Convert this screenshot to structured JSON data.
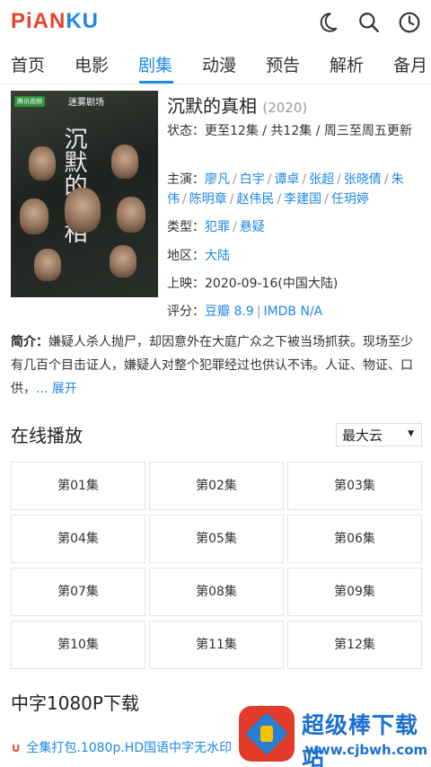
{
  "brand": {
    "logo_pian": "PiAN",
    "logo_ku": "KU"
  },
  "topbar": {
    "icons": [
      "moon-icon",
      "search-icon",
      "history-clock-icon"
    ]
  },
  "nav": {
    "items": [
      "首页",
      "电影",
      "剧集",
      "动漫",
      "预告",
      "解析",
      "备月"
    ],
    "active_index": 2
  },
  "poster": {
    "badge": "腾讯视频",
    "brand": "迷雾剧场",
    "title": "沉默的真相"
  },
  "detail": {
    "title": "沉默的真相",
    "year": "(2020)",
    "status_label": "状态：",
    "status": "更至12集 / 共12集 / 周三至周五更新",
    "cast_label": "主演：",
    "cast": [
      "廖凡",
      "白宇",
      "谭卓",
      "张超",
      "张晓倩",
      "朱伟",
      "陈明章",
      "赵伟民",
      "李建国",
      "任玥婷"
    ],
    "genre_label": "类型：",
    "genre": [
      "犯罪",
      "悬疑"
    ],
    "region_label": "地区：",
    "region": "大陆",
    "release_label": "上映：",
    "release": "2020-09-16(中国大陆)",
    "rating_label": "评分：",
    "rating_douban": "豆瓣 8.9",
    "rating_imdb": "IMDB N/A"
  },
  "intro": {
    "label": "简介：",
    "text": "嫌疑人杀人抛尸，却因意外在大庭广众之下被当场抓获。现场至少有几百个目击证人，嫌疑人对整个犯罪经过也供认不讳。人证、物证、口供，",
    "more": "... 展开"
  },
  "online": {
    "title": "在线播放",
    "source": "最大云",
    "episodes": [
      "第01集",
      "第02集",
      "第03集",
      "第04集",
      "第05集",
      "第06集",
      "第07集",
      "第08集",
      "第09集",
      "第10集",
      "第11集",
      "第12集"
    ]
  },
  "download": {
    "title": "中字1080P下载",
    "item": "全集打包.1080p.HD国语中字无水印"
  },
  "watermark": {
    "text": "超级棒下载站",
    "url": "www.cjbwh.com"
  },
  "colors": {
    "accent": "#1e88e5",
    "brand_red": "#e8412c"
  }
}
